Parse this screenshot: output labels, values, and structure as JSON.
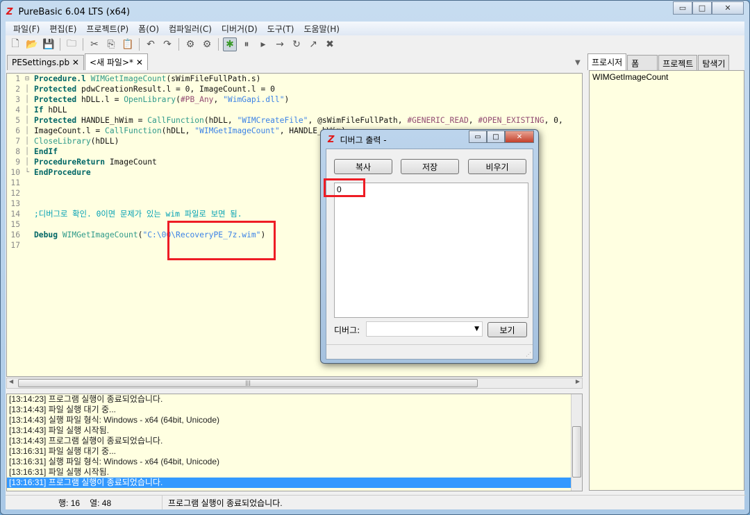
{
  "window": {
    "title": "PureBasic 6.04 LTS (x64)",
    "logo": "Z"
  },
  "menu": [
    "파일(F)",
    "편집(E)",
    "프로젝트(P)",
    "폼(O)",
    "컴파일러(C)",
    "디버거(D)",
    "도구(T)",
    "도움말(H)"
  ],
  "toolbar": [
    "new-file-icon",
    "open-file-icon",
    "save-icon",
    "|",
    "close-file-icon",
    "|",
    "cut-icon",
    "copy-icon",
    "paste-icon",
    "|",
    "undo-icon",
    "redo-icon",
    "|",
    "compile-run-icon",
    "build-icon",
    "|",
    "debugger-icon",
    "pause-icon",
    "continue-icon",
    "step-icon",
    "step-over-icon",
    "step-out-icon",
    "kill-icon"
  ],
  "tabs": [
    {
      "label": "PESettings.pb ✕",
      "selected": false
    },
    {
      "label": "<새 파일>* ✕",
      "selected": true
    }
  ],
  "code": [
    [
      [
        "kw",
        "Procedure.l "
      ],
      [
        "fn",
        "WIMGetImageCount"
      ],
      [
        "tx",
        "(sWimFileFullPath.s)"
      ]
    ],
    [
      [
        "kw",
        "Protected "
      ],
      [
        "tx",
        "pdwCreationResult.l = 0, ImageCount.l = 0"
      ]
    ],
    [
      [
        "kw",
        "Protected "
      ],
      [
        "tx",
        "hDLL.l = "
      ],
      [
        "fn",
        "OpenLibrary"
      ],
      [
        "tx",
        "("
      ],
      [
        "cn",
        "#PB_Any"
      ],
      [
        "tx",
        ", "
      ],
      [
        "st",
        "\"WimGapi.dll\""
      ],
      [
        "tx",
        ")"
      ]
    ],
    [
      [
        "kw",
        "If "
      ],
      [
        "tx",
        "hDLL"
      ]
    ],
    [
      [
        "kw",
        "Protected "
      ],
      [
        "tx",
        "HANDLE_hWim = "
      ],
      [
        "fn",
        "CallFunction"
      ],
      [
        "tx",
        "(hDLL, "
      ],
      [
        "st",
        "\"WIMCreateFile\""
      ],
      [
        "tx",
        ", @sWimFileFullPath, "
      ],
      [
        "cn",
        "#GENERIC_READ"
      ],
      [
        "tx",
        ", "
      ],
      [
        "cn",
        "#OPEN_EXISTING"
      ],
      [
        "tx",
        ", 0,"
      ]
    ],
    [
      [
        "tx",
        "ImageCount.l = "
      ],
      [
        "fn",
        "CallFunction"
      ],
      [
        "tx",
        "(hDLL, "
      ],
      [
        "st",
        "\"WIMGetImageCount\""
      ],
      [
        "tx",
        ", HANDLE_hWim)"
      ]
    ],
    [
      [
        "fn",
        "CloseLibrary"
      ],
      [
        "tx",
        "(hDLL)"
      ]
    ],
    [
      [
        "kw",
        "EndIf"
      ]
    ],
    [
      [
        "kw",
        "ProcedureReturn "
      ],
      [
        "tx",
        "ImageCount"
      ]
    ],
    [
      [
        "kw",
        "EndProcedure"
      ]
    ],
    [],
    [],
    [],
    [
      [
        "cm",
        ";디버그로 확인. 0이면 문제가 있는 wim 파일로 보면 됨."
      ]
    ],
    [],
    [
      [
        "kw",
        "Debug "
      ],
      [
        "fn",
        "WIMGetImageCount"
      ],
      [
        "tx",
        "("
      ],
      [
        "st",
        "\"C:\\00\\RecoveryPE_7z.wim\""
      ],
      [
        "tx",
        ")"
      ]
    ],
    []
  ],
  "log": [
    "[13:14:23] 프로그램 실행이 종료되었습니다.",
    "[13:14:43] 파일 실행 대기 중...",
    "[13:14:43] 실행 파일 형식: Windows - x64  (64bit, Unicode)",
    "[13:14:43] 파일 실행 시작됨.",
    "[13:14:43] 프로그램 실행이 종료되었습니다.",
    "[13:16:31] 파일 실행 대기 중...",
    "[13:16:31] 실행 파일 형식: Windows - x64  (64bit, Unicode)",
    "[13:16:31] 파일 실행 시작됨.",
    "[13:16:31] 프로그램 실행이 종료되었습니다."
  ],
  "status": {
    "line": "행: 16",
    "col": "열: 48",
    "message": "프로그램 실행이 종료되었습니다."
  },
  "right_panel": {
    "tabs": [
      "프로시저",
      "폼",
      "프로젝트",
      "탐색기"
    ],
    "items": [
      "WIMGetImageCount"
    ]
  },
  "debug_dialog": {
    "title": "디버그 출력 -",
    "copy": "복사",
    "save": "저장",
    "clear": "비우기",
    "output": [
      "0"
    ],
    "debug_label": "디버그:",
    "combo_value": "",
    "view": "보기"
  },
  "colors": {
    "accent_selection": "#3399ff",
    "highlight_box": "#ee1c24",
    "editor_bg": "#ffffe1"
  }
}
